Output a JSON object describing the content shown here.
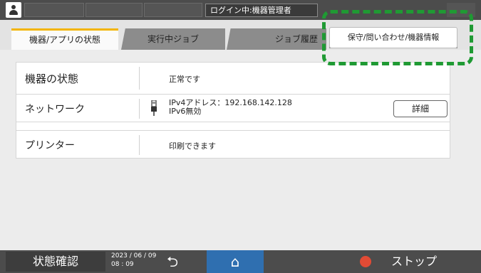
{
  "topbar": {
    "login_status": "ログイン中:機器管理者"
  },
  "tabs": {
    "tab1": "機器/アプリの状態",
    "tab2": "実行中ジョブ",
    "tab3": "ジョブ履歴",
    "tab4": "保守/問い合わせ/機器情報"
  },
  "device_status": {
    "label": "機器の状態",
    "value": "正常です"
  },
  "network": {
    "label": "ネットワーク",
    "ipv4": "IPv4アドレス：192.168.142.128",
    "ipv6": "IPv6無効",
    "detail_button": "詳細"
  },
  "printer": {
    "label": "プリンター",
    "value": "印刷できます"
  },
  "bottombar": {
    "status_check": "状態確認",
    "date": "2023 / 06 / 09",
    "time": "08 : 09",
    "stop": "ストップ"
  },
  "colors": {
    "accent_tab": "#f3b400",
    "home": "#2f6fb0",
    "stop": "#e24b35",
    "annotation": "#1f9a33"
  }
}
